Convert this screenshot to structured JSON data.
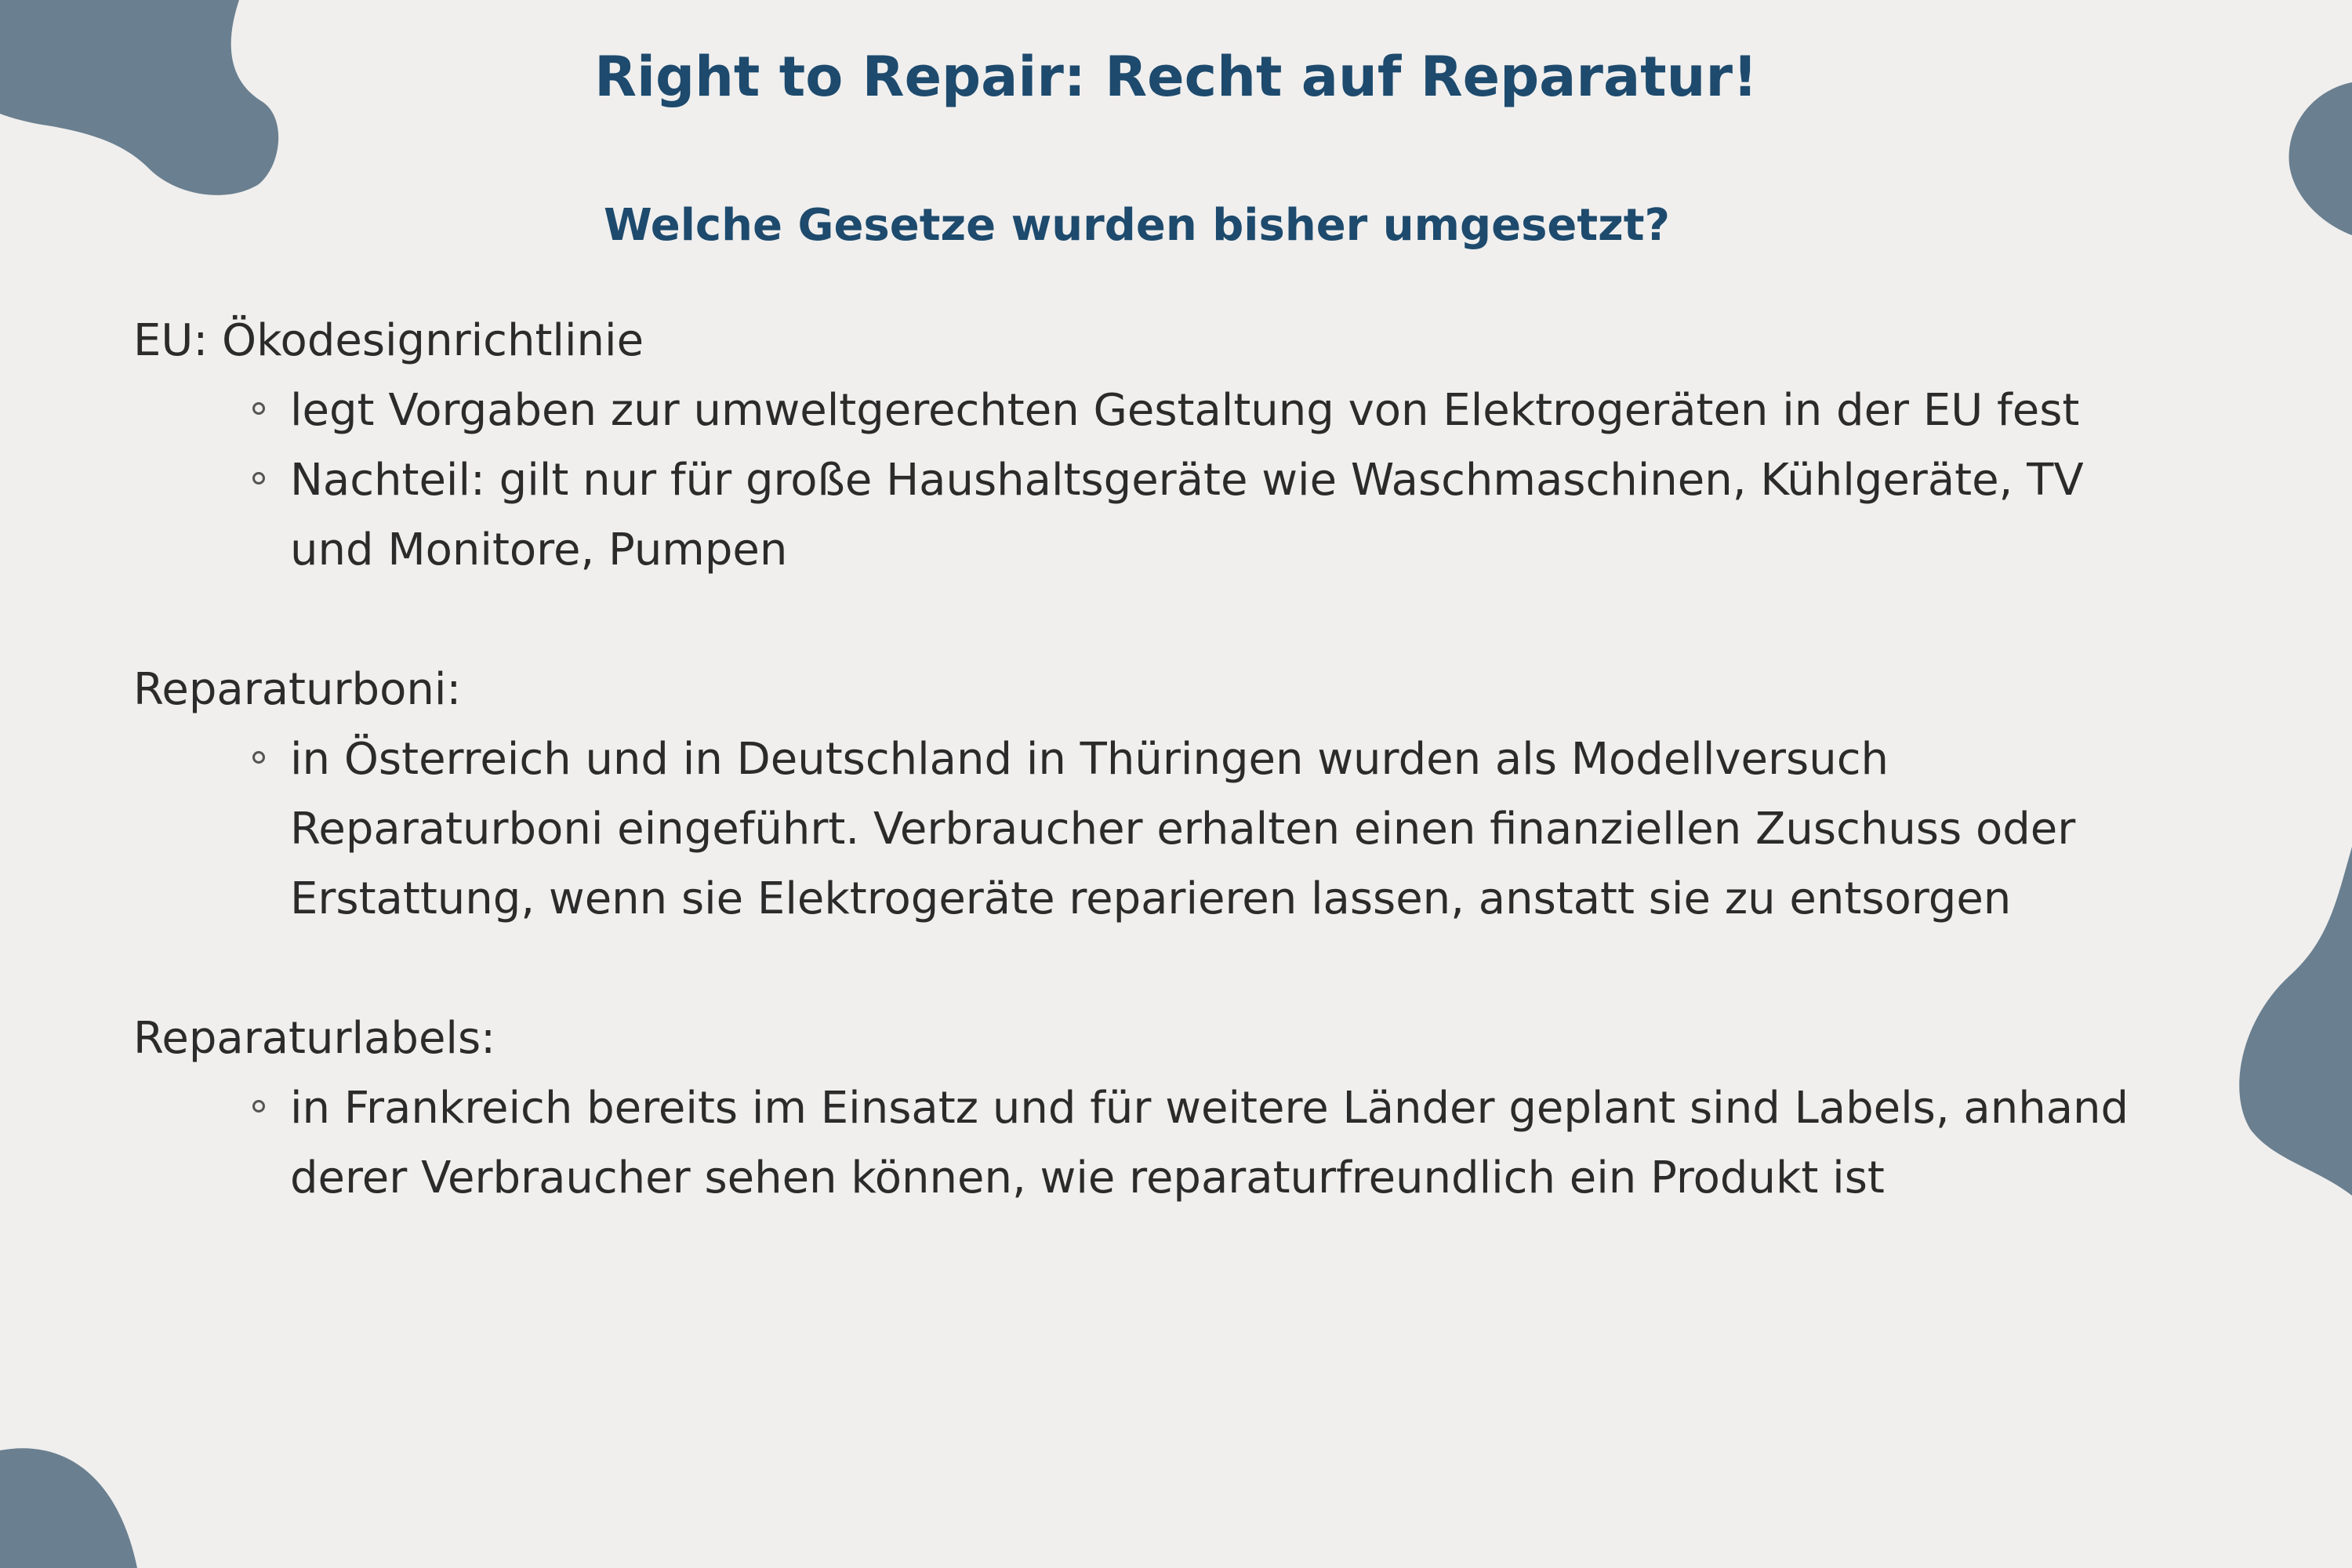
{
  "title": "Right to Repair: Recht auf Reparatur!",
  "subtitle": "Welche Gesetze wurden bisher umgesetzt?",
  "sections": [
    {
      "heading": "EU: Ökodesignrichtlinie",
      "items": [
        "legt Vorgaben zur umweltgerechten Gestaltung von Elektrogeräten in der EU fest",
        "Nachteil: gilt nur für große Haushaltsgeräte wie Waschmaschinen, Kühlgeräte, TV und Monitore, Pumpen"
      ]
    },
    {
      "heading": "Reparaturboni:",
      "items": [
        "in Österreich und in Deutschland in Thüringen wurden als Modellversuch Reparaturboni eingeführt. Verbraucher erhalten einen finanziellen Zuschuss oder Erstattung, wenn sie Elektrogeräte reparieren lassen, anstatt sie zu entsorgen"
      ]
    },
    {
      "heading": "Reparaturlabels:",
      "items": [
        "in Frankreich bereits im Einsatz und für weitere Länder geplant sind Labels, anhand derer Verbraucher sehen können, wie reparaturfreundlich ein Produkt ist"
      ]
    }
  ],
  "colors": {
    "background": "#f0efee",
    "heading": "#1d4a6d",
    "body_text": "#2b2b2b",
    "blob": "#6a7f8f"
  }
}
